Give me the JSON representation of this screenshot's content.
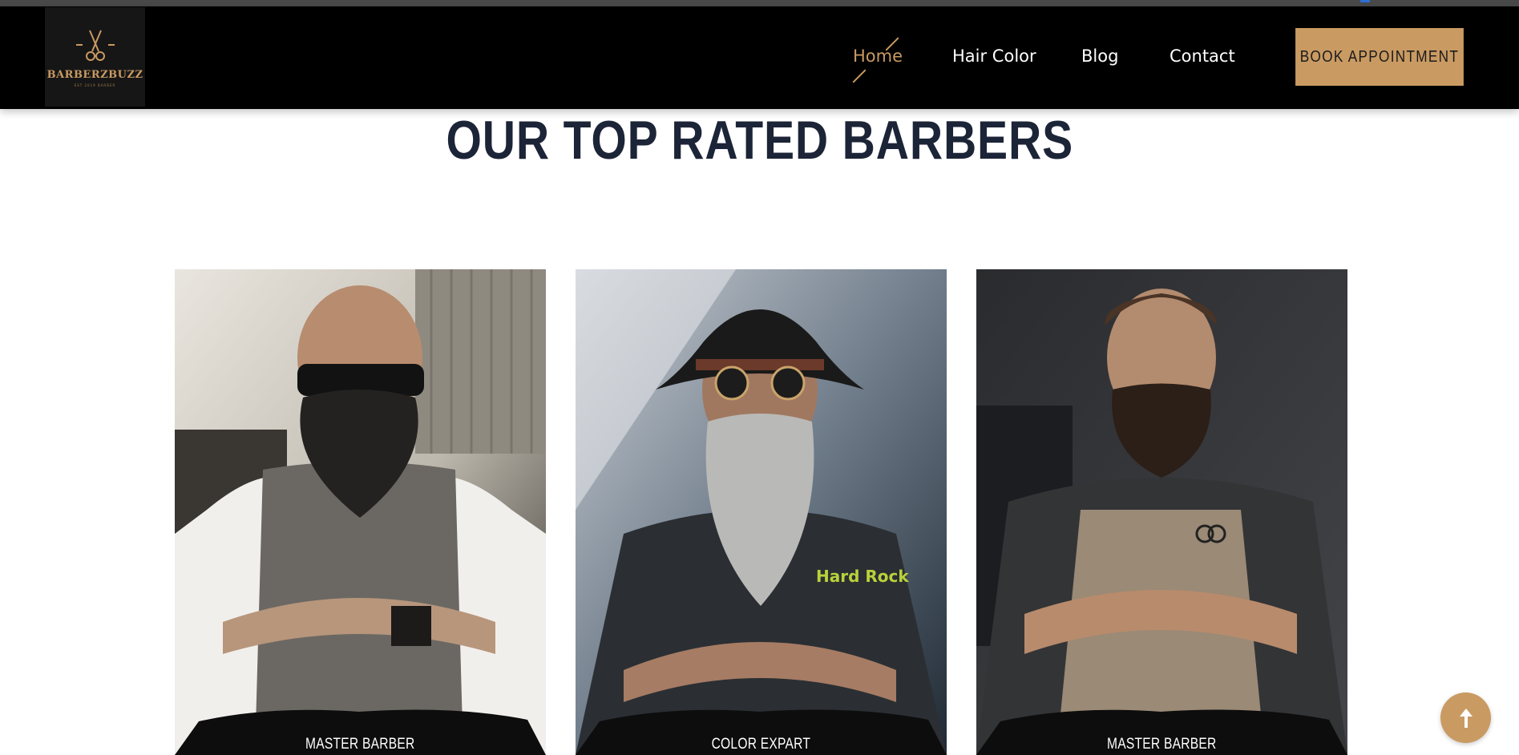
{
  "brand": {
    "name": "BARBERZBUZZ",
    "tagline": "EST 2019 BARBER",
    "accent_color": "#c99a62"
  },
  "nav": {
    "items": [
      {
        "label": "Home",
        "active": true
      },
      {
        "label": "Hair Color",
        "active": false
      },
      {
        "label": "Blog",
        "active": false
      },
      {
        "label": "Contact",
        "active": false
      }
    ],
    "cta_label": "BOOK APPOINTMENT"
  },
  "section": {
    "title": "OUR TOP RATED BARBERS"
  },
  "barbers": [
    {
      "role": "MASTER BARBER",
      "photo": "bearded-man-sunglasses-vest-icon"
    },
    {
      "role": "COLOR EXPART",
      "photo": "bearded-man-hat-round-glasses-icon"
    },
    {
      "role": "MASTER BARBER",
      "photo": "bearded-man-apron-scissors-icon"
    }
  ],
  "scroll_top": {
    "icon": "arrow-up-icon"
  }
}
